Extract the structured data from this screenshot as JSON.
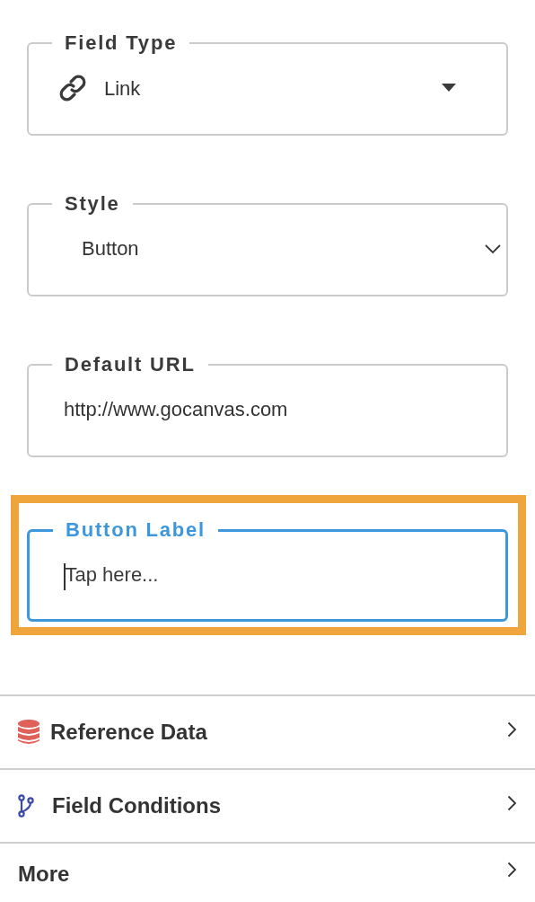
{
  "fields": [
    {
      "kind": "dropdown",
      "label": "Field Type",
      "value": "Link",
      "focused": false,
      "highlighted": false
    },
    {
      "kind": "select",
      "label": "Style",
      "value": "Button",
      "focused": false,
      "highlighted": false
    },
    {
      "kind": "text",
      "label": "Default URL",
      "value": "http://www.gocanvas.com",
      "focused": false,
      "highlighted": false
    },
    {
      "kind": "text",
      "label": "Button Label",
      "placeholder": "Tap here...",
      "focused": true,
      "highlighted": true
    }
  ],
  "sections": [
    {
      "label": "Reference Data"
    },
    {
      "label": "Field Conditions"
    },
    {
      "label": "More"
    }
  ]
}
